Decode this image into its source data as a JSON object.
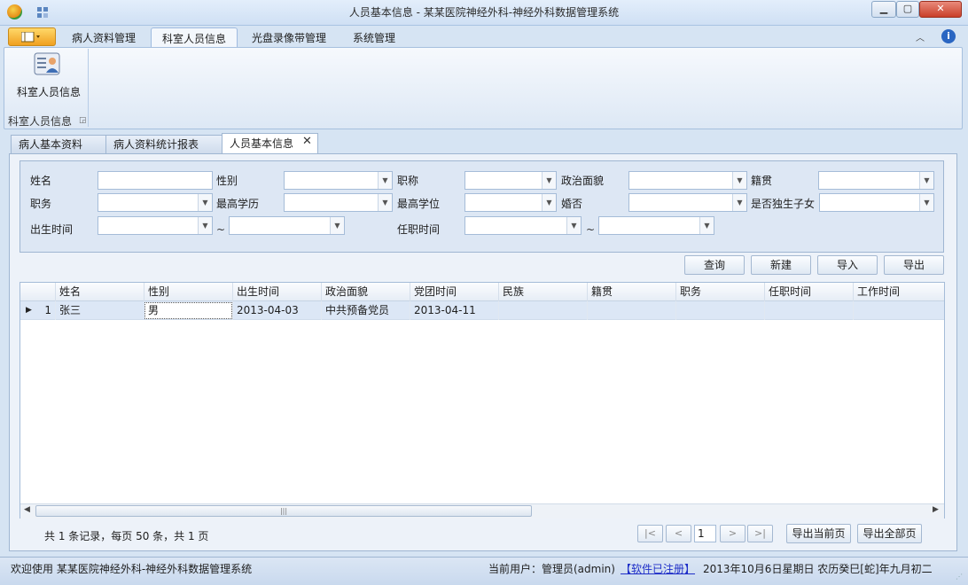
{
  "window": {
    "title": "人员基本信息 - 某某医院神经外科-神经外科数据管理系统",
    "app_icon": "app-logo-icon",
    "quick_access_icon": "quick-access-icon"
  },
  "ribbon": {
    "tabs": [
      "病人资料管理",
      "科室人员信息",
      "光盘录像带管理",
      "系统管理"
    ],
    "active_tab": "科室人员信息",
    "button_label": "科室人员信息",
    "group_label": "科室人员信息"
  },
  "doc_tabs": [
    "病人基本资料",
    "病人资料统计报表",
    "人员基本信息"
  ],
  "filters": {
    "name": "姓名",
    "gender": "性别",
    "title": "职称",
    "political": "政治面貌",
    "native_place": "籍贯",
    "position": "职务",
    "education": "最高学历",
    "degree": "最高学位",
    "marital": "婚否",
    "only_child": "是否独生子女",
    "birth_date": "出生时间",
    "appoint_date": "任职时间",
    "range_sep": "~"
  },
  "actions": {
    "query": "查询",
    "new": "新建",
    "import": "导入",
    "export": "导出"
  },
  "grid": {
    "columns": [
      "姓名",
      "性别",
      "出生时间",
      "政治面貌",
      "党团时间",
      "民族",
      "籍贯",
      "职务",
      "任职时间",
      "工作时间"
    ],
    "rows": [
      {
        "num": "1",
        "name": "张三",
        "gender": "男",
        "birth": "2013-04-03",
        "political": "中共预备党员",
        "party_date": "2013-04-11"
      }
    ]
  },
  "pager": {
    "record_info": "共 1 条记录，每页 50 条，共 1 页",
    "first": "|<",
    "prev": "<",
    "page": "1",
    "next": ">",
    "last": ">|",
    "export_current": "导出当前页",
    "export_all": "导出全部页"
  },
  "status": {
    "welcome": "欢迎使用 某某医院神经外科-神经外科数据管理系统",
    "user": "当前用户：管理员(admin)",
    "registered": "【软件已注册】",
    "date": "2013年10月6日星期日 农历癸巳[蛇]年九月初二"
  },
  "colors": {
    "accent": "#2a66c2",
    "row_selected": "#dce7f6",
    "link": "#1f2fc8"
  }
}
